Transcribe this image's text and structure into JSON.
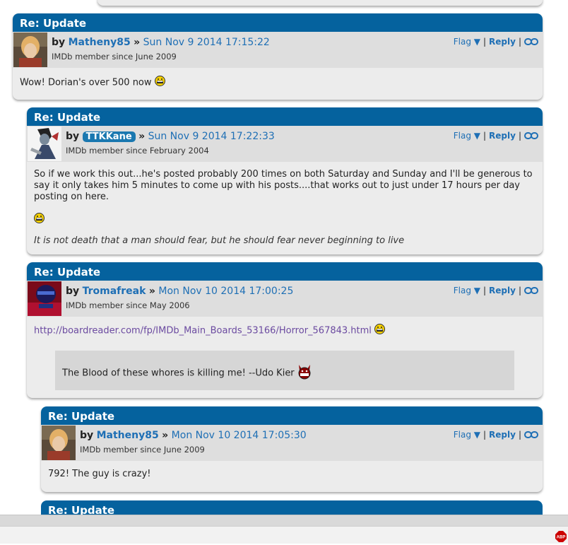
{
  "posts": [
    {
      "title": "Re: Update",
      "by_label": "by",
      "username": "Matheny85",
      "separator": "»",
      "date": "Sun Nov 9 2014 17:15:22",
      "member_since": "IMDb member since June 2009",
      "flag": "Flag ▼",
      "reply": "Reply",
      "body": "Wow! Dorian's over 500 now"
    },
    {
      "title": "Re: Update",
      "by_label": "by",
      "username": "TTKKane",
      "separator": "»",
      "date": "Sun Nov 9 2014 17:22:33",
      "member_since": "IMDb member since February 2004",
      "flag": "Flag ▼",
      "reply": "Reply",
      "body": "So if we work this out...he's posted probably 200 times on both Saturday and Sunday and I'll be generous to say it only takes him 5 minutes to come up with his posts....that works out to just under 17 hours per day posting on here.",
      "signature": "It is not death that a man should fear, but he should fear never beginning to live"
    },
    {
      "title": "Re: Update",
      "by_label": "by",
      "username": "Tromafreak",
      "separator": "»",
      "date": "Mon Nov 10 2014 17:00:25",
      "member_since": "IMDb member since May 2006",
      "flag": "Flag ▼",
      "reply": "Reply",
      "link": "http://boardreader.com/fp/IMDb_Main_Boards_53166/Horror_567843.html",
      "quote": "The Blood of these whores is killing me! --Udo Kier"
    },
    {
      "title": "Re: Update",
      "by_label": "by",
      "username": "Matheny85",
      "separator": "»",
      "date": "Mon Nov 10 2014 17:05:30",
      "member_since": "IMDb member since June 2009",
      "flag": "Flag ▼",
      "reply": "Reply",
      "body": "792! The guy is crazy!"
    },
    {
      "title": "Re: Update"
    }
  ],
  "colors": {
    "title_bar": "#05629e",
    "link": "#1e6fb5",
    "post_bg": "#ececec",
    "header_bg": "#dedede"
  },
  "icons": [
    "smiley-icon",
    "devil-smiley-icon",
    "permalink-icon",
    "adblock-icon"
  ]
}
